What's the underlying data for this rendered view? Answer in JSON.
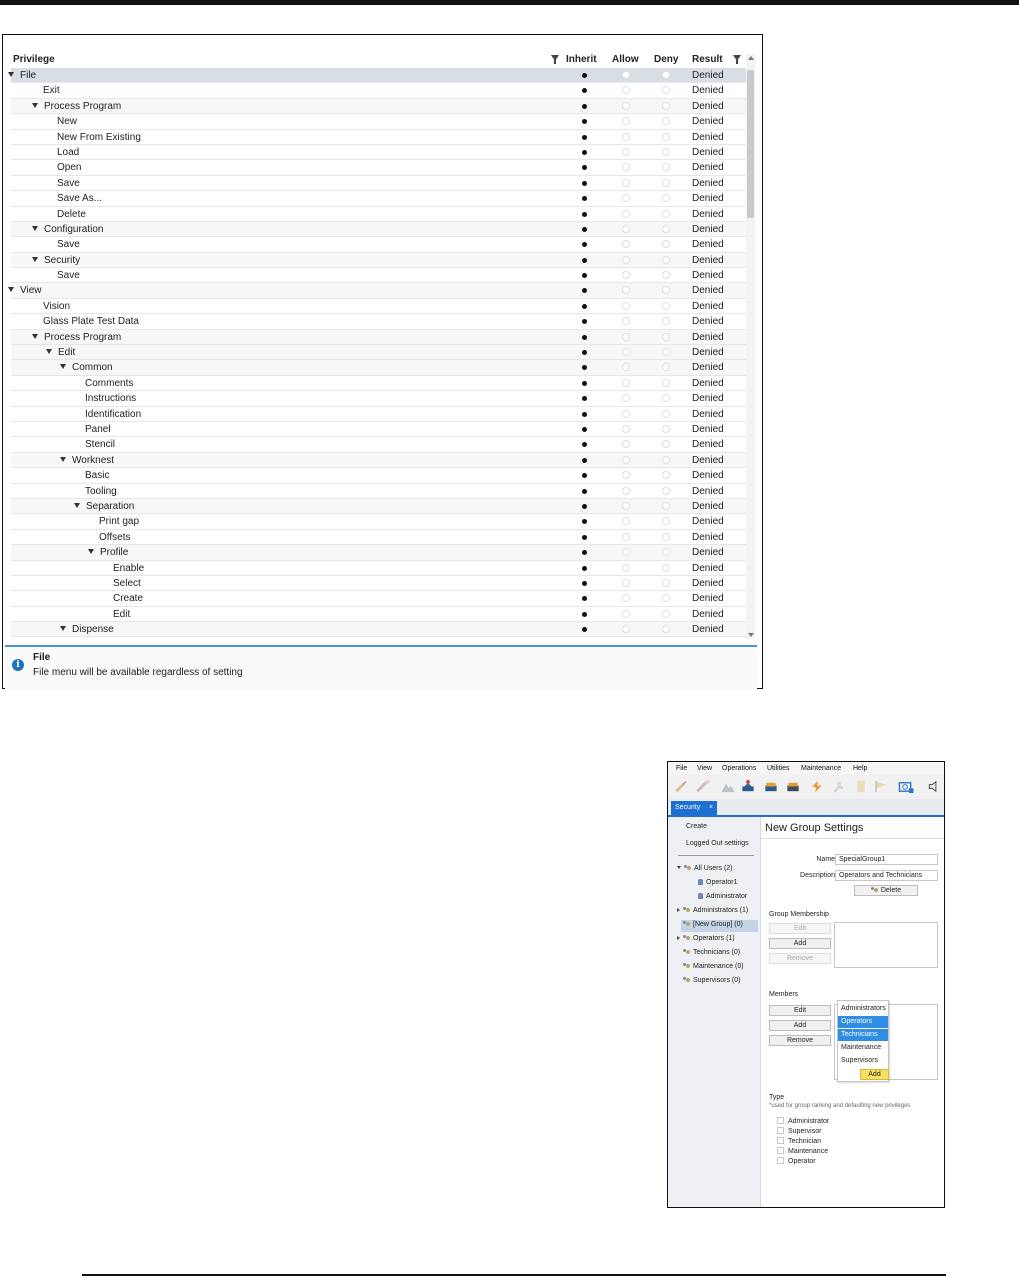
{
  "privileges_panel": {
    "headers": {
      "privilege": "Privilege",
      "inherit": "Inherit",
      "allow": "Allow",
      "deny": "Deny",
      "result": "Result"
    },
    "rows": [
      {
        "label": "File",
        "level": 0,
        "expandable": true,
        "result": "Denied"
      },
      {
        "label": "Exit",
        "level": 1,
        "expandable": false,
        "result": "Denied"
      },
      {
        "label": "Process Program",
        "level": 1,
        "expandable": true,
        "result": "Denied"
      },
      {
        "label": "New",
        "level": 2,
        "expandable": false,
        "result": "Denied"
      },
      {
        "label": "New From Existing",
        "level": 2,
        "expandable": false,
        "result": "Denied"
      },
      {
        "label": "Load",
        "level": 2,
        "expandable": false,
        "result": "Denied"
      },
      {
        "label": "Open",
        "level": 2,
        "expandable": false,
        "result": "Denied"
      },
      {
        "label": "Save",
        "level": 2,
        "expandable": false,
        "result": "Denied"
      },
      {
        "label": "Save As...",
        "level": 2,
        "expandable": false,
        "result": "Denied"
      },
      {
        "label": "Delete",
        "level": 2,
        "expandable": false,
        "result": "Denied"
      },
      {
        "label": "Configuration",
        "level": 1,
        "expandable": true,
        "result": "Denied"
      },
      {
        "label": "Save",
        "level": 2,
        "expandable": false,
        "result": "Denied"
      },
      {
        "label": "Security",
        "level": 1,
        "expandable": true,
        "result": "Denied"
      },
      {
        "label": "Save",
        "level": 2,
        "expandable": false,
        "result": "Denied"
      },
      {
        "label": "View",
        "level": 0,
        "expandable": true,
        "result": "Denied"
      },
      {
        "label": "Vision",
        "level": 1,
        "expandable": false,
        "result": "Denied"
      },
      {
        "label": "Glass Plate Test Data",
        "level": 1,
        "expandable": false,
        "result": "Denied"
      },
      {
        "label": "Process Program",
        "level": 1,
        "expandable": true,
        "result": "Denied"
      },
      {
        "label": "Edit",
        "level": 2,
        "expandable": true,
        "result": "Denied"
      },
      {
        "label": "Common",
        "level": 3,
        "expandable": true,
        "result": "Denied"
      },
      {
        "label": "Comments",
        "level": 4,
        "expandable": false,
        "result": "Denied"
      },
      {
        "label": "Instructions",
        "level": 4,
        "expandable": false,
        "result": "Denied"
      },
      {
        "label": "Identification",
        "level": 4,
        "expandable": false,
        "result": "Denied"
      },
      {
        "label": "Panel",
        "level": 4,
        "expandable": false,
        "result": "Denied"
      },
      {
        "label": "Stencil",
        "level": 4,
        "expandable": false,
        "result": "Denied"
      },
      {
        "label": "Worknest",
        "level": 3,
        "expandable": true,
        "result": "Denied"
      },
      {
        "label": "Basic",
        "level": 4,
        "expandable": false,
        "result": "Denied"
      },
      {
        "label": "Tooling",
        "level": 4,
        "expandable": false,
        "result": "Denied"
      },
      {
        "label": "Separation",
        "level": 4,
        "expandable": true,
        "result": "Denied"
      },
      {
        "label": "Print gap",
        "level": 5,
        "expandable": false,
        "result": "Denied"
      },
      {
        "label": "Offsets",
        "level": 5,
        "expandable": false,
        "result": "Denied"
      },
      {
        "label": "Profile",
        "level": 5,
        "expandable": true,
        "result": "Denied"
      },
      {
        "label": "Enable",
        "level": 6,
        "expandable": false,
        "result": "Denied"
      },
      {
        "label": "Select",
        "level": 6,
        "expandable": false,
        "result": "Denied"
      },
      {
        "label": "Create",
        "level": 6,
        "expandable": false,
        "result": "Denied"
      },
      {
        "label": "Edit",
        "level": 6,
        "expandable": false,
        "result": "Denied"
      },
      {
        "label": "Dispense",
        "level": 3,
        "expandable": true,
        "result": "Denied"
      }
    ],
    "info": {
      "title": "File",
      "description": "File menu will be available regardless of setting"
    }
  },
  "group_app": {
    "menu": [
      "File",
      "View",
      "Operations",
      "Utilities",
      "Maintenance",
      "Help"
    ],
    "tab": {
      "label": "Security",
      "close": "×"
    },
    "left": {
      "create": "Create",
      "logged_out": "Logged Out settings",
      "tree": [
        {
          "label": "All Users (2)",
          "kind": "group",
          "state": "expanded"
        },
        {
          "label": "Operator1",
          "kind": "user",
          "state": "child"
        },
        {
          "label": "Administrator",
          "kind": "user",
          "state": "child"
        },
        {
          "label": "Administrators (1)",
          "kind": "group",
          "state": "collapsed"
        },
        {
          "label": "[New Group] (0)",
          "kind": "group",
          "state": "selected"
        },
        {
          "label": "Operators (1)",
          "kind": "group",
          "state": "collapsed"
        },
        {
          "label": "Technicians (0)",
          "kind": "group",
          "state": "leaf"
        },
        {
          "label": "Maintenance (0)",
          "kind": "group",
          "state": "leaf"
        },
        {
          "label": "Supervisors (0)",
          "kind": "group",
          "state": "leaf"
        }
      ]
    },
    "right": {
      "title": "New Group Settings",
      "name_label": "Name:",
      "name_value": "SpecialGroup1",
      "desc_label": "Description:",
      "desc_value": "Operators and Technicians",
      "delete_label": "Delete",
      "group_membership": "Group Membership",
      "gm_edit": "Edit",
      "gm_add": "Add",
      "gm_remove": "Remove",
      "dropdown_items": [
        "Administrators",
        "Operators",
        "Technicians",
        "Maintenance",
        "Supervisors"
      ],
      "dropdown_add": "Add",
      "members": "Members",
      "m_edit": "Edit",
      "m_add": "Add",
      "m_remove": "Remove",
      "type_label": "Type",
      "type_hint": "*used for group ranking and defaulting new privileges",
      "types": [
        "Administrator",
        "Supervisor",
        "Technician",
        "Maintenance",
        "Operator"
      ]
    }
  }
}
